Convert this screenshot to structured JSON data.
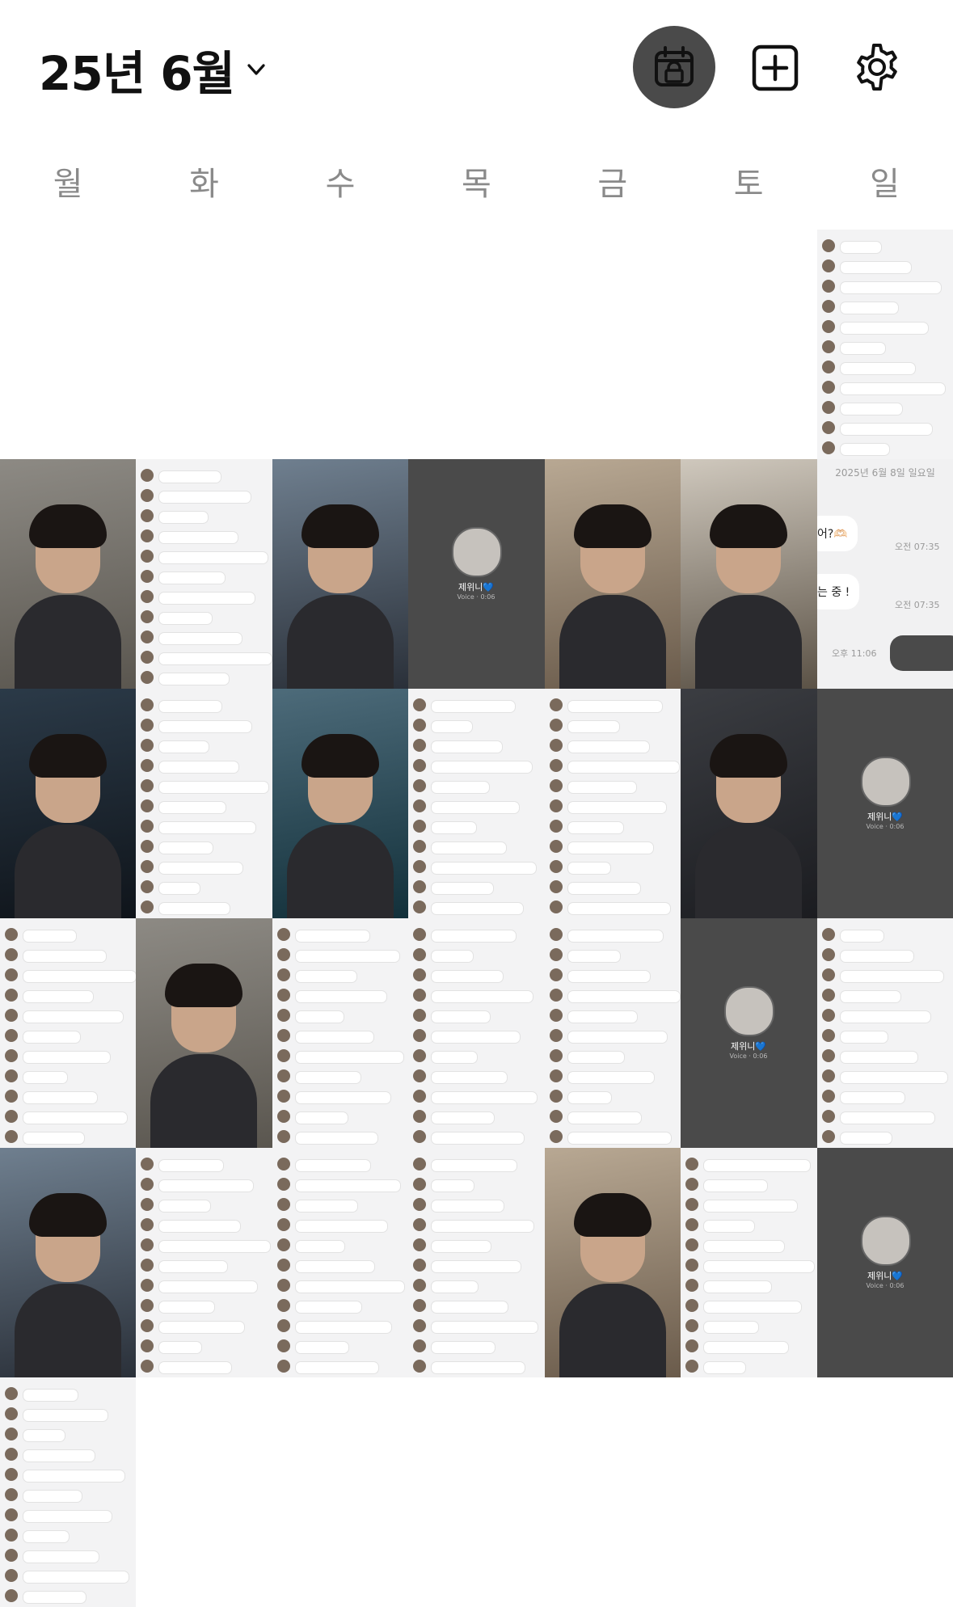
{
  "header": {
    "month_label": "25년 6월",
    "icons": {
      "dropdown": "chevron-down-icon",
      "lock": "calendar-lock-icon",
      "add": "add-square-icon",
      "settings": "gear-icon"
    },
    "accent_color": "#4a4a4a"
  },
  "weekdays": [
    "월",
    "화",
    "수",
    "목",
    "금",
    "토",
    "일"
  ],
  "calendar": {
    "first_weekday_index": 6,
    "days": [
      {
        "type": "chat"
      },
      {
        "type": "photo"
      },
      {
        "type": "chat"
      },
      {
        "type": "photo"
      },
      {
        "type": "call"
      },
      {
        "type": "photo"
      },
      {
        "type": "photo"
      },
      {
        "type": "zoomchat"
      },
      {
        "type": "photo"
      },
      {
        "type": "chat"
      },
      {
        "type": "photo"
      },
      {
        "type": "chat"
      },
      {
        "type": "chat"
      },
      {
        "type": "photo"
      },
      {
        "type": "call"
      },
      {
        "type": "chat"
      },
      {
        "type": "photo"
      },
      {
        "type": "chat"
      },
      {
        "type": "chat"
      },
      {
        "type": "chat"
      },
      {
        "type": "call"
      },
      {
        "type": "chat"
      },
      {
        "type": "photo"
      },
      {
        "type": "chat"
      },
      {
        "type": "chat"
      },
      {
        "type": "chat"
      },
      {
        "type": "photo"
      },
      {
        "type": "chat"
      },
      {
        "type": "call"
      },
      {
        "type": "chat"
      }
    ]
  },
  "call_thumbnail": {
    "name": "제위니💙",
    "sub": "Voice · 0:06"
  },
  "zoom_chat": {
    "date": "2025년 6월 8일 일요일",
    "msg1": "어?🫶🏻",
    "time1": "오전 07:35",
    "msg2": "는 중 !",
    "time2": "오전 07:35",
    "time3": "오후 11:06"
  }
}
